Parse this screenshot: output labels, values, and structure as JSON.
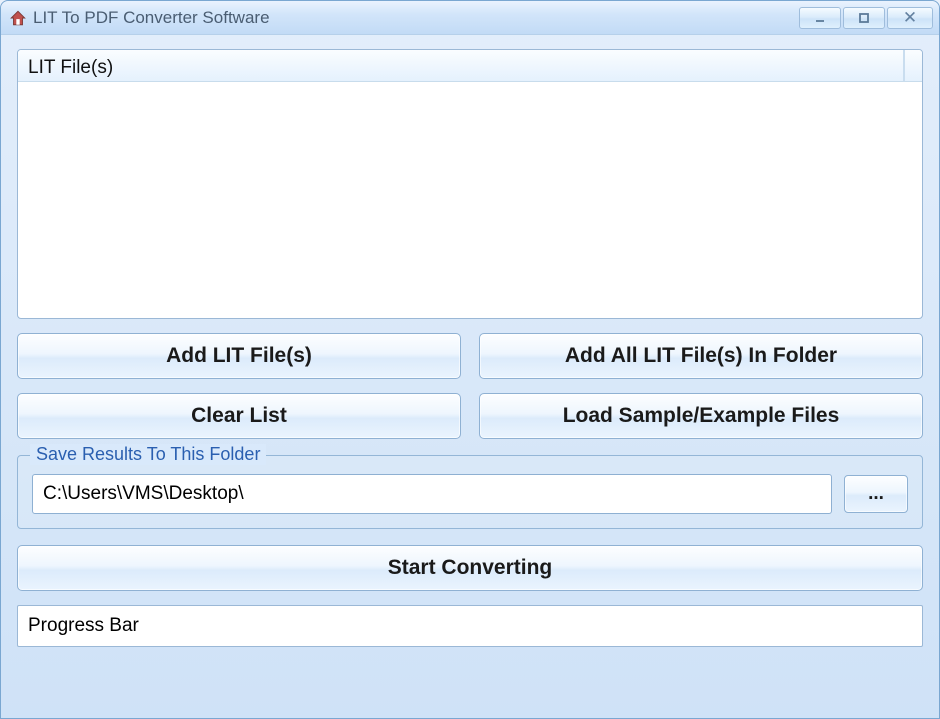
{
  "window": {
    "title": "LIT To PDF Converter Software"
  },
  "list": {
    "header": "LIT File(s)"
  },
  "buttons": {
    "add_files": "Add LIT File(s)",
    "add_folder": "Add All LIT File(s) In Folder",
    "clear_list": "Clear List",
    "load_sample": "Load Sample/Example Files",
    "browse": "...",
    "start": "Start Converting"
  },
  "save_group": {
    "legend": "Save Results To This Folder",
    "path": "C:\\Users\\VMS\\Desktop\\"
  },
  "progress": {
    "label": "Progress Bar"
  }
}
